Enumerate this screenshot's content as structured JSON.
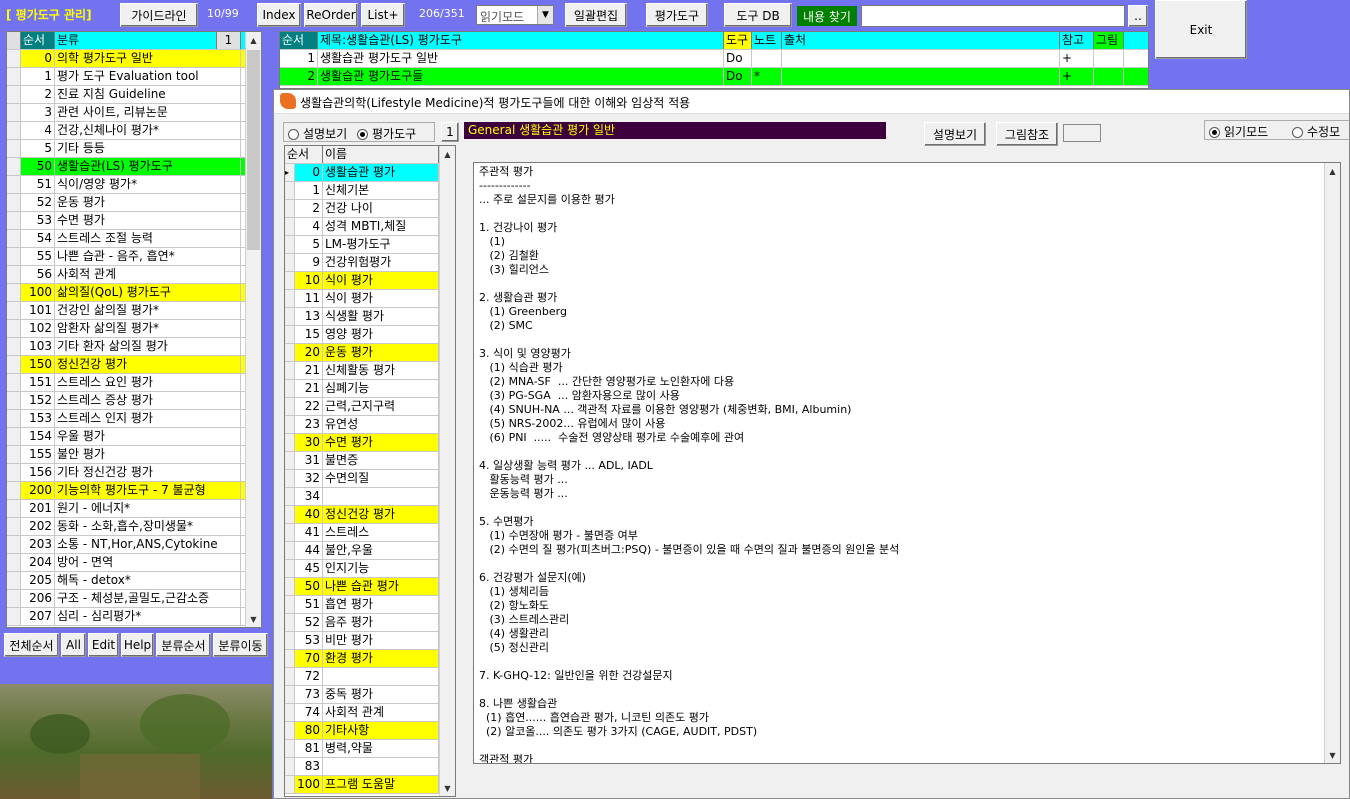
{
  "toolbar": {
    "app_title": "[ 평가도구 관리]",
    "guideline_label": "가이드라인",
    "counter1": "10/99",
    "index_label": "Index",
    "reorder_label": "ReOrder",
    "listplus_label": "List+",
    "counter2": "206/351",
    "mode_select_value": "읽기모드",
    "bulk_edit_label": "일괄편집",
    "eval_tool_label": "평가도구",
    "tool_db_label": "도구 DB",
    "content_search_label": "내용 찾기",
    "search_value": "",
    "dots_label": "..",
    "exit_label": "Exit"
  },
  "left_grid": {
    "headers": [
      "순서",
      "분류",
      "1"
    ],
    "rows": [
      {
        "n": "0",
        "t": "의학 평가도구 일반",
        "c": "yellow"
      },
      {
        "n": "1",
        "t": "평가 도구 Evaluation tool",
        "c": ""
      },
      {
        "n": "2",
        "t": "진료 지침 Guideline",
        "c": ""
      },
      {
        "n": "3",
        "t": "관련 사이트, 리뷰논문",
        "c": ""
      },
      {
        "n": "4",
        "t": "건강,신체나이 평가*",
        "c": ""
      },
      {
        "n": "5",
        "t": "기타 등등",
        "c": ""
      },
      {
        "n": "50",
        "t": "생활습관(LS) 평가도구",
        "c": "green"
      },
      {
        "n": "51",
        "t": "식이/영양 평가*",
        "c": ""
      },
      {
        "n": "52",
        "t": "운동 평가",
        "c": ""
      },
      {
        "n": "53",
        "t": "수면 평가",
        "c": ""
      },
      {
        "n": "54",
        "t": "스트레스 조절 능력",
        "c": ""
      },
      {
        "n": "55",
        "t": "나쁜 습관 - 음주, 흡연*",
        "c": ""
      },
      {
        "n": "56",
        "t": "사회적 관계",
        "c": ""
      },
      {
        "n": "100",
        "t": "삶의질(QoL) 평가도구",
        "c": "yellow"
      },
      {
        "n": "101",
        "t": "건강인 삶의질 평가*",
        "c": ""
      },
      {
        "n": "102",
        "t": "암환자 삶의질 평가*",
        "c": ""
      },
      {
        "n": "103",
        "t": "기타 환자 삶의질 평가",
        "c": ""
      },
      {
        "n": "150",
        "t": "정신건강 평가",
        "c": "yellow"
      },
      {
        "n": "151",
        "t": "스트레스 요인 평가",
        "c": ""
      },
      {
        "n": "152",
        "t": "스트레스 증상 평가",
        "c": ""
      },
      {
        "n": "153",
        "t": "스트레스 인지 평가",
        "c": ""
      },
      {
        "n": "154",
        "t": "우울 평가",
        "c": ""
      },
      {
        "n": "155",
        "t": "불안 평가",
        "c": ""
      },
      {
        "n": "156",
        "t": "기타 정신건강 평가",
        "c": ""
      },
      {
        "n": "200",
        "t": "기능의학 평가도구 - 7 불균형",
        "c": "yellow"
      },
      {
        "n": "201",
        "t": "원기 - 에너지*",
        "c": ""
      },
      {
        "n": "202",
        "t": "동화 - 소화,흡수,장미생물*",
        "c": ""
      },
      {
        "n": "203",
        "t": "소통 - NT,Hor,ANS,Cytokine",
        "c": ""
      },
      {
        "n": "204",
        "t": "방어 - 면역",
        "c": ""
      },
      {
        "n": "205",
        "t": "해독 - detox*",
        "c": ""
      },
      {
        "n": "206",
        "t": "구조 - 체성분,골밀도,근감소증",
        "c": ""
      },
      {
        "n": "207",
        "t": "심리 - 심리평가*",
        "c": ""
      }
    ]
  },
  "bottom_buttons": [
    "전체순서",
    "All",
    "Edit",
    "Help",
    "분류순서",
    "분류이동"
  ],
  "top_grid": {
    "headers": [
      "순서",
      "제목:생활습관(LS) 평가도구",
      "도구",
      "노트",
      "출처",
      "참고",
      "그림"
    ],
    "rows": [
      {
        "n": "1",
        "t": "생활습관 평가도구 일반",
        "d": "Do",
        "note": "",
        "src": "",
        "ref": "+",
        "c": ""
      },
      {
        "n": "2",
        "t": "생활습관 평가도구들",
        "d": "Do",
        "note": "*",
        "src": "",
        "ref": "+",
        "c": "green"
      }
    ]
  },
  "dialog": {
    "title": "생활습관의학(Lifestyle Medicine)적 평가도구들에 대한 이해와 임상적 적용",
    "radio_desc": "설명보기",
    "radio_tool": "평가도구",
    "num_badge": "1",
    "topic_title": "General 생활습관 평가 일반",
    "view_desc_label": "설명보기",
    "figure_ref_label": "그림참조",
    "read_mode_label": "읽기모드",
    "edit_mode_label": "수정모"
  },
  "inner_grid": {
    "headers": [
      "순서",
      "이름"
    ],
    "rows": [
      {
        "n": "0",
        "t": "생활습관 평가",
        "c": "yellow",
        "cur": true
      },
      {
        "n": "1",
        "t": "신체기본",
        "c": ""
      },
      {
        "n": "2",
        "t": "건강 나이",
        "c": ""
      },
      {
        "n": "4",
        "t": "성격 MBTI,체질",
        "c": ""
      },
      {
        "n": "5",
        "t": "LM-평가도구",
        "c": ""
      },
      {
        "n": "9",
        "t": "건강위험평가",
        "c": ""
      },
      {
        "n": "10",
        "t": "식이 평가",
        "c": "yellow"
      },
      {
        "n": "11",
        "t": "식이 평가",
        "c": ""
      },
      {
        "n": "13",
        "t": "식생활 평가",
        "c": ""
      },
      {
        "n": "15",
        "t": "영양 평가",
        "c": ""
      },
      {
        "n": "20",
        "t": "운동 평가",
        "c": "yellow"
      },
      {
        "n": "21",
        "t": "신체활동 평가",
        "c": ""
      },
      {
        "n": "21",
        "t": "심폐기능",
        "c": ""
      },
      {
        "n": "22",
        "t": "근력,근지구력",
        "c": ""
      },
      {
        "n": "23",
        "t": "유연성",
        "c": ""
      },
      {
        "n": "30",
        "t": "수면 평가",
        "c": "yellow"
      },
      {
        "n": "31",
        "t": "불면증",
        "c": ""
      },
      {
        "n": "32",
        "t": "수면의질",
        "c": ""
      },
      {
        "n": "34",
        "t": "",
        "c": ""
      },
      {
        "n": "40",
        "t": "정신건강 평가",
        "c": "yellow"
      },
      {
        "n": "41",
        "t": "스트레스",
        "c": ""
      },
      {
        "n": "44",
        "t": "불안,우울",
        "c": ""
      },
      {
        "n": "45",
        "t": "인지기능",
        "c": ""
      },
      {
        "n": "50",
        "t": "나쁜 습관 평가",
        "c": "yellow"
      },
      {
        "n": "51",
        "t": "흡연 평가",
        "c": ""
      },
      {
        "n": "52",
        "t": "음주 평가",
        "c": ""
      },
      {
        "n": "53",
        "t": "비만 평가",
        "c": ""
      },
      {
        "n": "70",
        "t": "환경 평가",
        "c": "yellow"
      },
      {
        "n": "72",
        "t": "",
        "c": ""
      },
      {
        "n": "73",
        "t": "중독 평가",
        "c": ""
      },
      {
        "n": "74",
        "t": "사회적 관계",
        "c": ""
      },
      {
        "n": "80",
        "t": "기타사항",
        "c": "yellow"
      },
      {
        "n": "81",
        "t": "병력,약물",
        "c": ""
      },
      {
        "n": "83",
        "t": "",
        "c": ""
      },
      {
        "n": "100",
        "t": "프그램 도움말",
        "c": "yellow"
      }
    ]
  },
  "text_area": {
    "lines": [
      "주관적 평가",
      "-------------",
      "... 주로 설문지를 이용한 평가",
      "",
      "1. 건강나이 평가",
      "   (1)",
      "   (2) 김철환",
      "   (3) 힐리언스",
      "",
      "2. 생활습관 평가",
      "   (1) Greenberg",
      "   (2) SMC",
      "",
      "3. 식이 및 영양평가",
      "   (1) 식습관 평가",
      "   (2) MNA-SF  ... 간단한 영양평가로 노인환자에 다용",
      "   (3) PG-SGA  ... 암환자용으로 많이 사용",
      "   (4) SNUH-NA ... 객관적 자료를 이용한 영양평가 (체중변화, BMI, Albumin)",
      "   (5) NRS-2002... 유럽에서 많이 사용",
      "   (6) PNI  .....  수술전 영양상태 평가로 수술예후에 관여",
      "",
      "4. 일상생활 능력 평가 ... ADL, IADL",
      "   활동능력 평가 ...",
      "   운동능력 평가 ...",
      "",
      "5. 수면평가",
      "   (1) 수면장애 평가 - 불면증 여부",
      "   (2) 수면의 질 평가(피츠버그:PSQ) - 불면증이 있을 때 수면의 질과 불면증의 원인을 분석",
      "",
      "6. 건강평가 설문지(예)",
      "   (1) 생체리듬",
      "   (2) 항노화도",
      "   (3) 스트레스관리",
      "   (4) 생활관리",
      "   (5) 정신관리",
      "",
      "7. K-GHQ-12: 일반인을 위한 건강설문지",
      "",
      "8. 나쁜 생활습관",
      "  (1) 흡연...... 흡연습관 평가, 니코틴 의존도 평가",
      "  (2) 알코올.... 의존도 평가 3가지 (CAGE, AUDIT, PDST)",
      "",
      "객관적 평가"
    ]
  },
  "colors": {
    "background": "#7373f0",
    "highlight_yellow": "#ffff00",
    "highlight_green": "#00ff00",
    "header_cyan": "#00ffff",
    "topic_bar": "#3c003c"
  }
}
